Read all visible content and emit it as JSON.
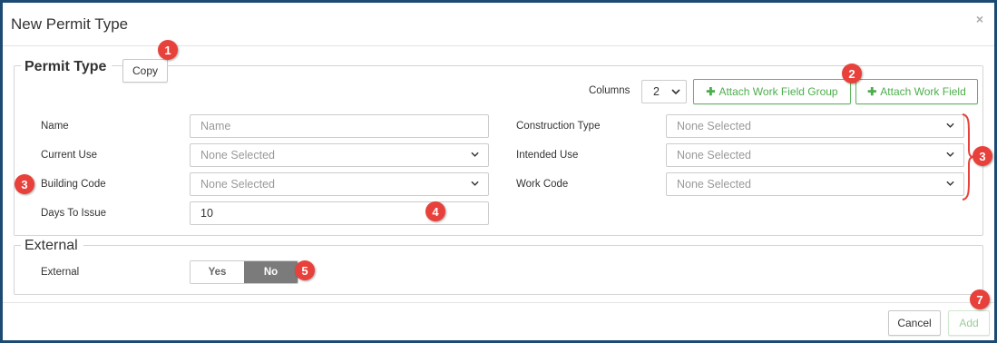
{
  "dialog": {
    "title": "New Permit Type",
    "close_glyph": "×"
  },
  "permit_type": {
    "legend": "Permit Type",
    "copy_label": "Copy",
    "columns_label": "Columns",
    "columns_value": "2",
    "attach_group_label": "Attach Work Field Group",
    "attach_field_label": "Attach Work Field",
    "name_label": "Name",
    "name_placeholder": "Name",
    "current_use_label": "Current Use",
    "current_use_value": "None Selected",
    "building_code_label": "Building Code",
    "building_code_value": "None Selected",
    "days_label": "Days To Issue",
    "days_value": "10",
    "construction_type_label": "Construction Type",
    "construction_type_value": "None Selected",
    "intended_use_label": "Intended Use",
    "intended_use_value": "None Selected",
    "work_code_label": "Work Code",
    "work_code_value": "None Selected"
  },
  "external": {
    "legend": "External",
    "label": "External",
    "yes_label": "Yes",
    "no_label": "No",
    "selected": "No"
  },
  "footer": {
    "cancel_label": "Cancel",
    "add_label": "Add"
  },
  "callouts": {
    "c1": "1",
    "c2": "2",
    "c3a": "3",
    "c3b": "3",
    "c4": "4",
    "c5": "5",
    "c7": "7"
  },
  "colors": {
    "frame": "#1b4a73",
    "green": "#4cae4c",
    "toggle_active": "#7b7b7b",
    "callout": "#e8403a"
  }
}
